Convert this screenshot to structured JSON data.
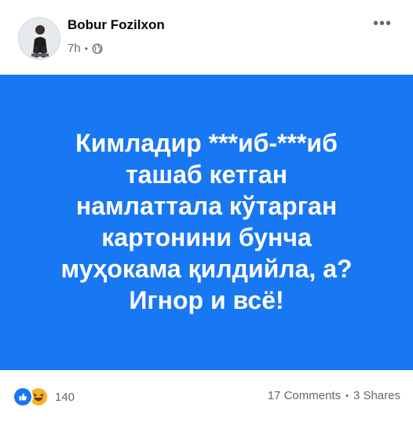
{
  "post": {
    "author": "Bobur Fozilxon",
    "time": "7h",
    "meta_separator": "•",
    "privacy_icon": "globe-icon",
    "more_label": "•••",
    "background_color": "#1877f2",
    "text_lines": [
      "Кимладир ***иб-***иб",
      "ташаб кетган",
      "намлаттала кўтарган",
      "картонини бунча",
      "муҳокама қилдийла, а?",
      "Игнор и всё!"
    ]
  },
  "footer": {
    "reaction_icons": [
      "like-icon",
      "haha-icon"
    ],
    "reaction_count": "140",
    "comments": "17 Comments",
    "separator": "•",
    "shares": "3 Shares"
  }
}
